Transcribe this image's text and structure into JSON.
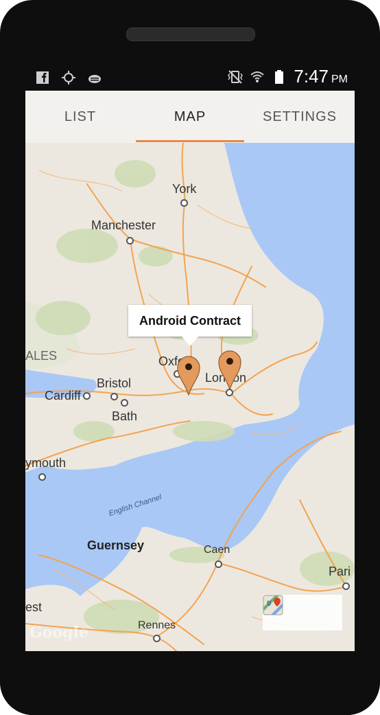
{
  "status_bar": {
    "icons_left": [
      "facebook-icon",
      "gps-icon",
      "android-debug-icon"
    ],
    "icons_right": [
      "vibrate-icon",
      "wifi-icon",
      "battery-icon"
    ],
    "time": "7:47",
    "ampm": "PM"
  },
  "tabs": [
    {
      "label": "LIST",
      "active": false
    },
    {
      "label": "MAP",
      "active": true
    },
    {
      "label": "SETTINGS",
      "active": false
    }
  ],
  "map": {
    "callout": "Android Contract",
    "places": {
      "york": "York",
      "manchester": "Manchester",
      "wales": "ALES",
      "oxford": "Oxfo",
      "london": "London",
      "bristol": "Bristol",
      "cardiff": "Cardiff",
      "bath": "Bath",
      "plymouth": "ymouth",
      "english_channel": "English Channel",
      "guernsey": "Guernsey",
      "caen": "Caen",
      "paris": "Pari",
      "brest": "est",
      "rennes": "Rennes"
    },
    "watermark": "Google",
    "colors": {
      "land": "#ece8df",
      "water": "#a9c8f5",
      "road": "#f5a24f",
      "marker": "#e49a5c"
    }
  }
}
